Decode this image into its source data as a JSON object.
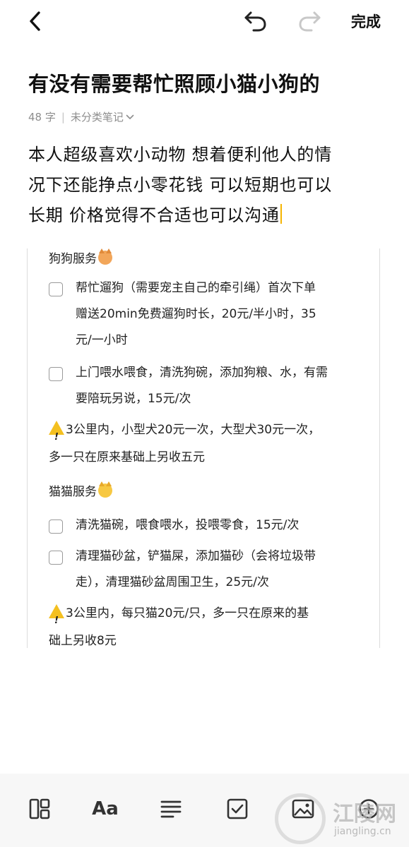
{
  "topbar": {
    "back_icon": "chevron-left-icon",
    "undo_icon": "undo-icon",
    "redo_icon": "redo-icon",
    "done_label": "完成"
  },
  "note": {
    "title": "有没有需要帮忙照顾小猫小狗的",
    "word_count": "48 字",
    "category": "未分类笔记",
    "body_lines": [
      "本人超级喜欢小动物 想着便利他人的情",
      "况下还能挣点小零花钱 可以短期也可以",
      "长期 价格觉得不合适也可以沟通"
    ]
  },
  "embed": {
    "dog_section": "狗狗服务",
    "dog_items": [
      [
        "帮忙遛狗（需要宠主自己的牵引绳）首次下单",
        "赠送20min免费遛狗时长，20元/半小时，35",
        "元/一小时"
      ],
      [
        "上门喂水喂食，清洗狗碗，添加狗粮、水，有需",
        "要陪玩另说，15元/次"
      ]
    ],
    "dog_note": [
      "3公里内，小型犬20元一次，大型犬30元一次，",
      "多一只在原来基础上另收五元"
    ],
    "cat_section": "猫猫服务",
    "cat_items": [
      [
        "清洗猫碗，喂食喂水，投喂零食，15元/次"
      ],
      [
        "清理猫砂盆，铲猫屎，添加猫砂（会将垃圾带",
        "走），清理猫砂盆周围卫生，25元/次"
      ]
    ],
    "cat_note": [
      "3公里内，每只猫20元/只，多一只在原来的基",
      "础上另收8元"
    ]
  },
  "toolbar": {
    "layout_icon": "layout-icon",
    "text_format_label": "Aa",
    "align_icon": "align-left-icon",
    "checklist_icon": "checkbox-icon",
    "image_icon": "image-icon",
    "more_icon": "plus-circle-icon"
  },
  "watermark": {
    "text": "江陵网",
    "url": "jiangling.cn"
  },
  "colors": {
    "caret": "#f5b400",
    "meta_text": "#8e8e8e",
    "toolbar_bg": "#f7f7f7"
  }
}
